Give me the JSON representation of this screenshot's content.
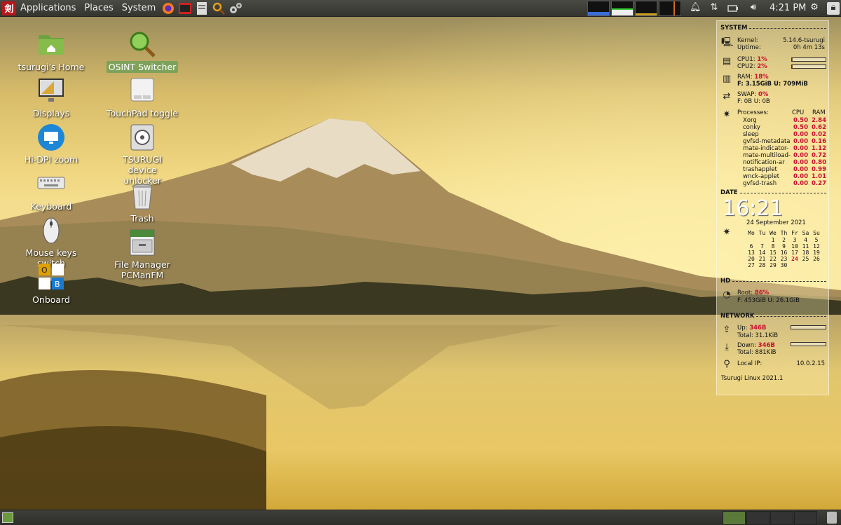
{
  "top_panel": {
    "logo": "剣",
    "menus": [
      "Applications",
      "Places",
      "System"
    ],
    "launchers": [
      "firefox-icon",
      "terminal-icon",
      "text-editor-icon",
      "search-icon",
      "settings-icon"
    ],
    "clock": "4:21 PM"
  },
  "desktop": {
    "col1": [
      {
        "name": "home-folder-icon",
        "label": "tsurugi's Home"
      },
      {
        "name": "displays-icon",
        "label": "Displays"
      },
      {
        "name": "hidpi-zoom-icon",
        "label": "Hi-DPI zoom"
      },
      {
        "name": "keyboard-icon",
        "label": "Keyboard"
      },
      {
        "name": "mouse-icon",
        "label": "Mouse keys switch"
      },
      {
        "name": "onboard-icon",
        "label": "Onboard"
      }
    ],
    "col2": [
      {
        "name": "osint-switcher-icon",
        "label": "OSINT Switcher"
      },
      {
        "name": "touchpad-icon",
        "label": "TouchPad toggle"
      },
      {
        "name": "device-unlocker-icon",
        "label": "TSURUGI device unlocker"
      },
      {
        "name": "trash-icon",
        "label": "Trash"
      },
      {
        "name": "file-manager-icon",
        "label": "File Manager PCManFM"
      }
    ]
  },
  "conky": {
    "system": {
      "header": "SYSTEM",
      "kernel_label": "Kernel:",
      "kernel_value": "5.14.6-tsurugi",
      "uptime_label": "Uptime:",
      "uptime_value": "0h 4m 13s",
      "cpu1_label": "CPU1:",
      "cpu1_value": "1%",
      "cpu1_fraction": 0.01,
      "cpu2_label": "CPU2:",
      "cpu2_value": "2%",
      "cpu2_fraction": 0.02,
      "ram_label": "RAM:",
      "ram_value": "18%",
      "ram_detail": "F: 3.15GiB U: 709MiB",
      "swap_label": "SWAP:",
      "swap_value": "0%",
      "swap_detail": "F: 0B   U: 0B",
      "processes_label": "Processes:",
      "cpu_col": "CPU",
      "ram_col": "RAM",
      "processes": [
        {
          "name": "Xorg",
          "cpu": "0.50",
          "ram": "2.84"
        },
        {
          "name": "conky",
          "cpu": "0.50",
          "ram": "0.62"
        },
        {
          "name": "sleep",
          "cpu": "0.00",
          "ram": "0.02"
        },
        {
          "name": "gvfsd-metadata",
          "cpu": "0.00",
          "ram": "0.16"
        },
        {
          "name": "mate-indicator-",
          "cpu": "0.00",
          "ram": "1.12"
        },
        {
          "name": "mate-multiload-",
          "cpu": "0.00",
          "ram": "0.72"
        },
        {
          "name": "notification-ar",
          "cpu": "0.00",
          "ram": "0.80"
        },
        {
          "name": "trashapplet",
          "cpu": "0.00",
          "ram": "0.99"
        },
        {
          "name": "wnck-applet",
          "cpu": "0.00",
          "ram": "1.01"
        },
        {
          "name": "gvfsd-trash",
          "cpu": "0.00",
          "ram": "0.27"
        }
      ]
    },
    "date": {
      "header": "DATE",
      "time": "16:21",
      "date": "24 September 2021",
      "weekdays": [
        "Mo",
        "Tu",
        "We",
        "Th",
        "Fr",
        "Sa",
        "Su"
      ],
      "weeks": [
        [
          "",
          "",
          "1",
          "2",
          "3",
          "4",
          "5"
        ],
        [
          "6",
          "7",
          "8",
          "9",
          "10",
          "11",
          "12"
        ],
        [
          "13",
          "14",
          "15",
          "16",
          "17",
          "18",
          "19"
        ],
        [
          "20",
          "21",
          "22",
          "23",
          "24",
          "25",
          "26"
        ],
        [
          "27",
          "28",
          "29",
          "30",
          "",
          "",
          ""
        ]
      ],
      "today": "24"
    },
    "hd": {
      "header": "HD",
      "root_label": "Root:",
      "root_value": "86%",
      "root_detail": "F: 453GiB U: 26.1GiB"
    },
    "network": {
      "header": "NETWORK",
      "up_label": "Up:",
      "up_value": "346B",
      "up_total": "Total: 31.1KiB",
      "down_label": "Down:",
      "down_value": "346B",
      "down_total": "Total: 881KiB",
      "ip_label": "Local IP:",
      "ip_value": "10.0.2.15"
    },
    "footer": "Tsurugi Linux 2021.1"
  }
}
